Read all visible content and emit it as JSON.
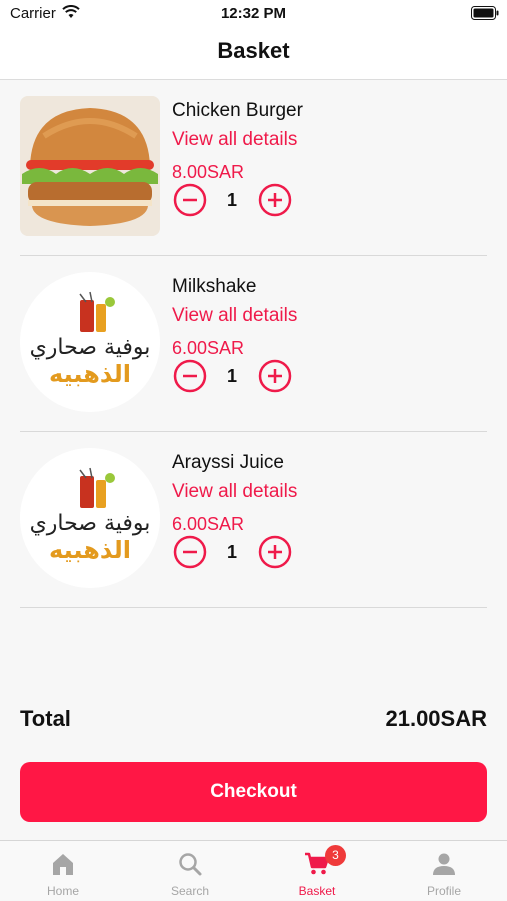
{
  "status_bar": {
    "carrier": "Carrier",
    "time": "12:32 PM"
  },
  "header": {
    "title": "Basket"
  },
  "items": [
    {
      "name": "Chicken Burger",
      "details_link": "View all details",
      "price": "8.00SAR",
      "quantity": "1",
      "thumbnail": "burger-photo"
    },
    {
      "name": "Milkshake",
      "details_link": "View all details",
      "price": "6.00SAR",
      "quantity": "1",
      "thumbnail": "buffet-logo"
    },
    {
      "name": "Arayssi Juice",
      "details_link": "View all details",
      "price": "6.00SAR",
      "quantity": "1",
      "thumbnail": "buffet-logo"
    }
  ],
  "logo": {
    "line1": "بوفية صحاري",
    "line2": "الذهبيه"
  },
  "summary": {
    "total_label": "Total",
    "total_value": "21.00SAR"
  },
  "checkout": {
    "label": "Checkout"
  },
  "tabs": [
    {
      "label": "Home",
      "icon": "home-icon"
    },
    {
      "label": "Search",
      "icon": "search-icon"
    },
    {
      "label": "Basket",
      "icon": "cart-icon",
      "badge": "3",
      "active": true
    },
    {
      "label": "Profile",
      "icon": "profile-icon"
    }
  ],
  "colors": {
    "accent": "#ef1a4a",
    "button": "#ff1745",
    "badge": "#ef3a3a",
    "inactive_tab": "#a6a6a6"
  }
}
